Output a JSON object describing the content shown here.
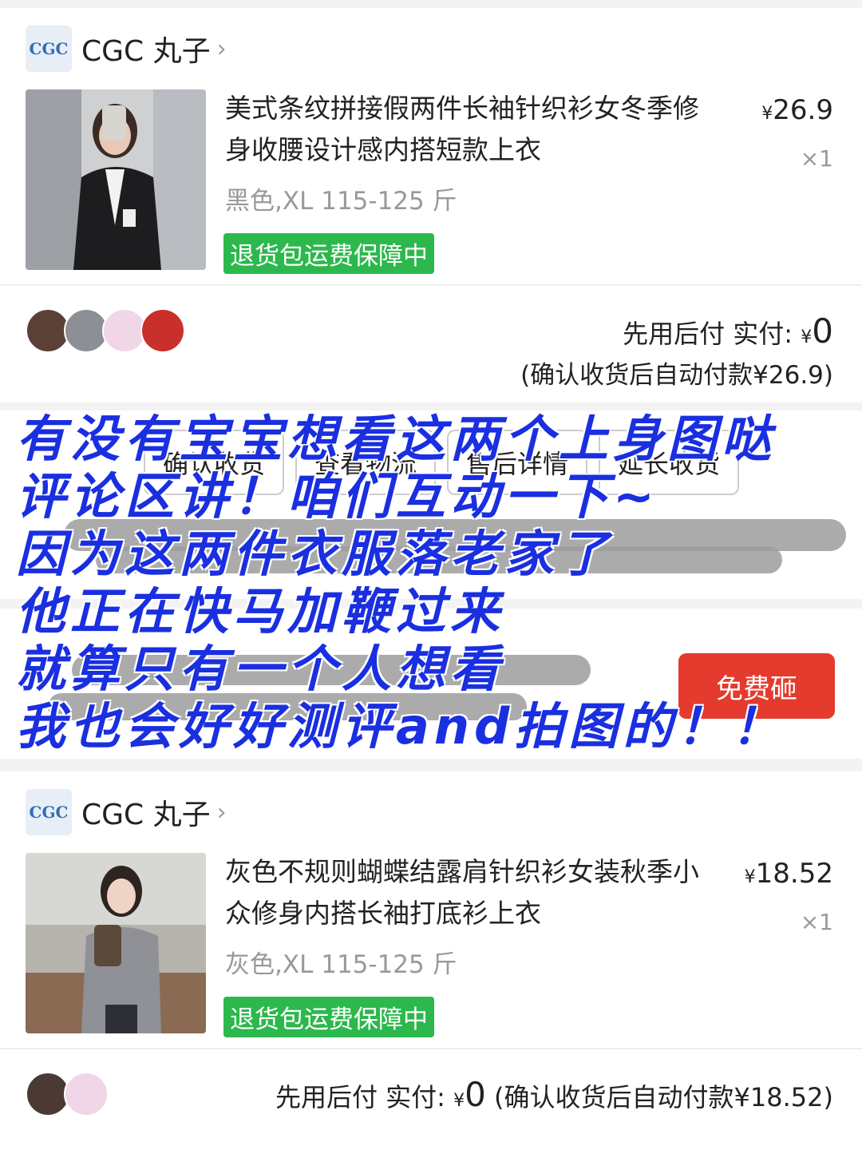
{
  "order1": {
    "shop_logo": "CGC",
    "shop_name": "CGC 丸子",
    "title": "美式条纹拼接假两件长袖针织衫女冬季修身收腰设计感内搭短款上衣",
    "price_symbol": "¥",
    "price": "26.9",
    "qty": "×1",
    "variant": "黑色,XL 115-125 斤",
    "badge": "退货包运费保障中",
    "pay_label": "先用后付 实付:",
    "pay_symbol": "¥",
    "pay_amount": "0",
    "pay_note": "(确认收货后自动付款¥26.9)"
  },
  "actions": {
    "confirm": "确认收货",
    "logistics": "查看物流",
    "after_sale": "售后详情",
    "extend": "延长收货"
  },
  "free_button": "免费砸",
  "order2": {
    "shop_logo": "CGC",
    "shop_name": "CGC 丸子",
    "title": "灰色不规则蝴蝶结露肩针织衫女装秋季小众修身内搭长袖打底衫上衣",
    "price_symbol": "¥",
    "price": "18.52",
    "qty": "×1",
    "variant": "灰色,XL 115-125 斤",
    "badge": "退货包运费保障中",
    "pay_label": "先用后付 实付:",
    "pay_symbol": "¥",
    "pay_amount": "0",
    "pay_note": "(确认收货后自动付款¥18.52)"
  },
  "overlay_lines": [
    "有没有宝宝想看这两个上身图哒",
    "评论区讲！咱们互动一下~",
    "因为这两件衣服落老家了",
    "他正在快马加鞭过来",
    "就算只有一个人想看",
    "我也会好好测评and拍图的！！"
  ]
}
